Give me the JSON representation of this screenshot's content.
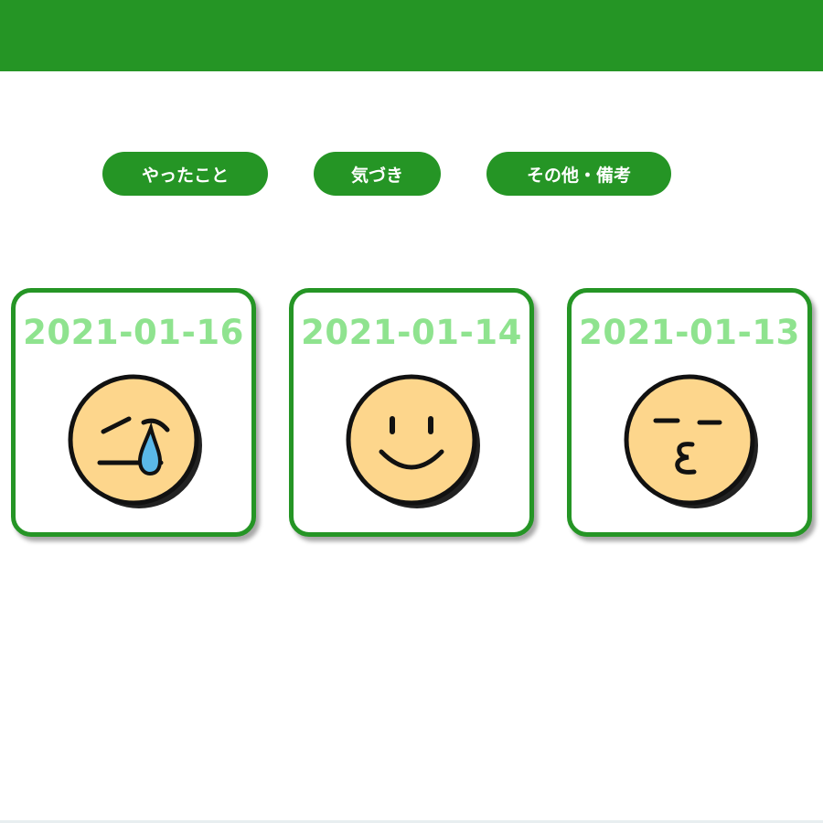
{
  "header": {
    "color": "#259525"
  },
  "tabs": [
    {
      "label": "やったこと"
    },
    {
      "label": "気づき"
    },
    {
      "label": "その他・備考"
    }
  ],
  "entries": [
    {
      "date": "2021-01-16",
      "mood_icon": "crying-face-icon"
    },
    {
      "date": "2021-01-14",
      "mood_icon": "smiling-face-icon"
    },
    {
      "date": "2021-01-13",
      "mood_icon": "kissing-face-icon"
    }
  ],
  "colors": {
    "accent": "#259525",
    "date_text": "#8fe38f",
    "face_fill": "#fdd68c",
    "tear": "#5ab8e8"
  }
}
